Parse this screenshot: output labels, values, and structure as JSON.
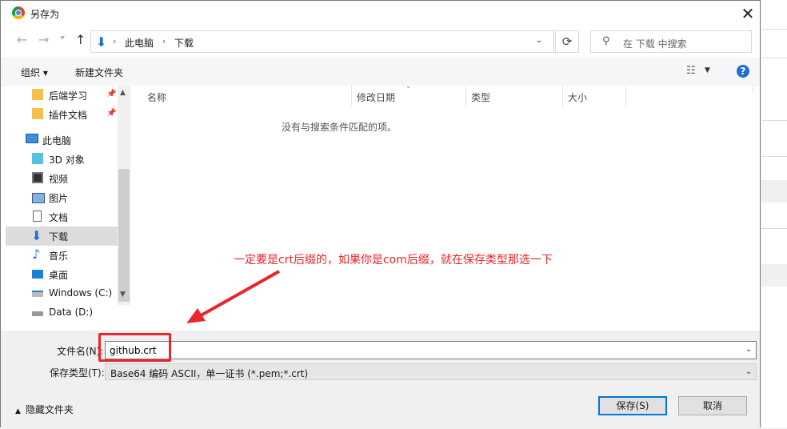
{
  "window": {
    "title": "另存为",
    "close_glyph": "✕"
  },
  "nav": {
    "back_glyph": "←",
    "forward_glyph": "→",
    "history_glyph": "⌄",
    "up_glyph": "↑",
    "breadcrumb": [
      "此电脑",
      "下载"
    ],
    "refresh_glyph": "⟳",
    "search_placeholder": "在 下载 中搜索"
  },
  "toolbar": {
    "organize": "组织 ▾",
    "new_folder": "新建文件夹",
    "help": "?"
  },
  "sidebar": {
    "items": [
      {
        "label": "后端学习",
        "icon": "folder-icon",
        "pinned": true
      },
      {
        "label": "插件文档",
        "icon": "folder-icon",
        "pinned": true
      },
      {
        "label": "此电脑",
        "icon": "computer-icon"
      },
      {
        "label": "3D 对象",
        "icon": "cube-icon"
      },
      {
        "label": "视频",
        "icon": "video-icon"
      },
      {
        "label": "图片",
        "icon": "picture-icon"
      },
      {
        "label": "文档",
        "icon": "document-icon"
      },
      {
        "label": "下载",
        "icon": "download-icon",
        "selected": true
      },
      {
        "label": "音乐",
        "icon": "music-icon"
      },
      {
        "label": "桌面",
        "icon": "desktop-icon"
      },
      {
        "label": "Windows (C:)",
        "icon": "drive-c-icon"
      },
      {
        "label": "Data (D:)",
        "icon": "drive-d-icon"
      }
    ]
  },
  "file_list": {
    "columns": [
      "名称",
      "修改日期",
      "类型",
      "大小"
    ],
    "empty_message": "没有与搜索条件匹配的项。"
  },
  "annotation": {
    "text": "一定要是crt后缀的，如果你是com后缀，就在保存类型那选一下",
    "color": "#e8262b"
  },
  "save": {
    "filename_label": "文件名(N):",
    "filename_value": "github.crt",
    "filetype_label": "保存类型(T):",
    "filetype_value": "Base64 编码 ASCII，单一证书 (*.pem;*.crt)",
    "hide_folders": "隐藏文件夹",
    "save_button": "保存(S)",
    "cancel_button": "取消"
  }
}
